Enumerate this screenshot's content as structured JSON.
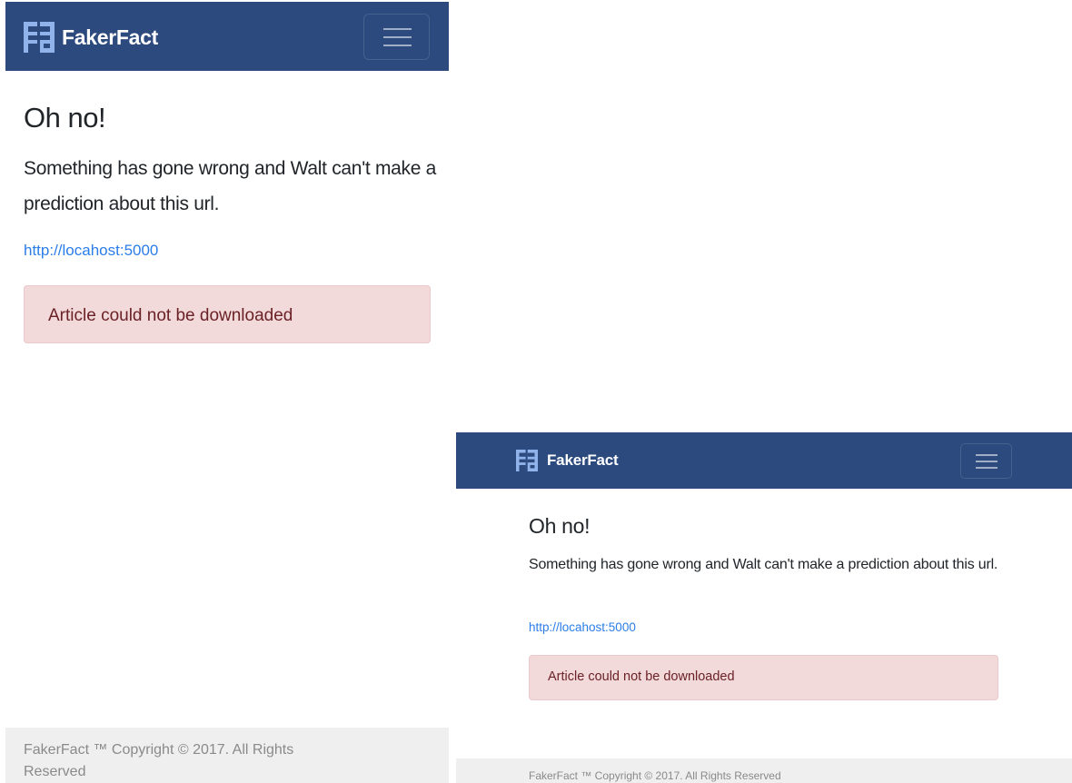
{
  "brand": {
    "name": "FakerFact",
    "logo_icon": "fakerfact-logo-icon",
    "logo_color": "#8fb3ea"
  },
  "navbar": {
    "background": "#2c4a7e",
    "toggler_icon": "hamburger-menu-icon"
  },
  "error": {
    "heading": "Oh no!",
    "message": "Something has gone wrong and Walt can't make a prediction about this url.",
    "url": "http://locahost:5000",
    "alert": "Article could not be downloaded",
    "alert_background": "#f2d9da",
    "alert_text_color": "#6b2226"
  },
  "footer": {
    "text": "FakerFact ™  Copyright © 2017. All Rights Reserved"
  }
}
